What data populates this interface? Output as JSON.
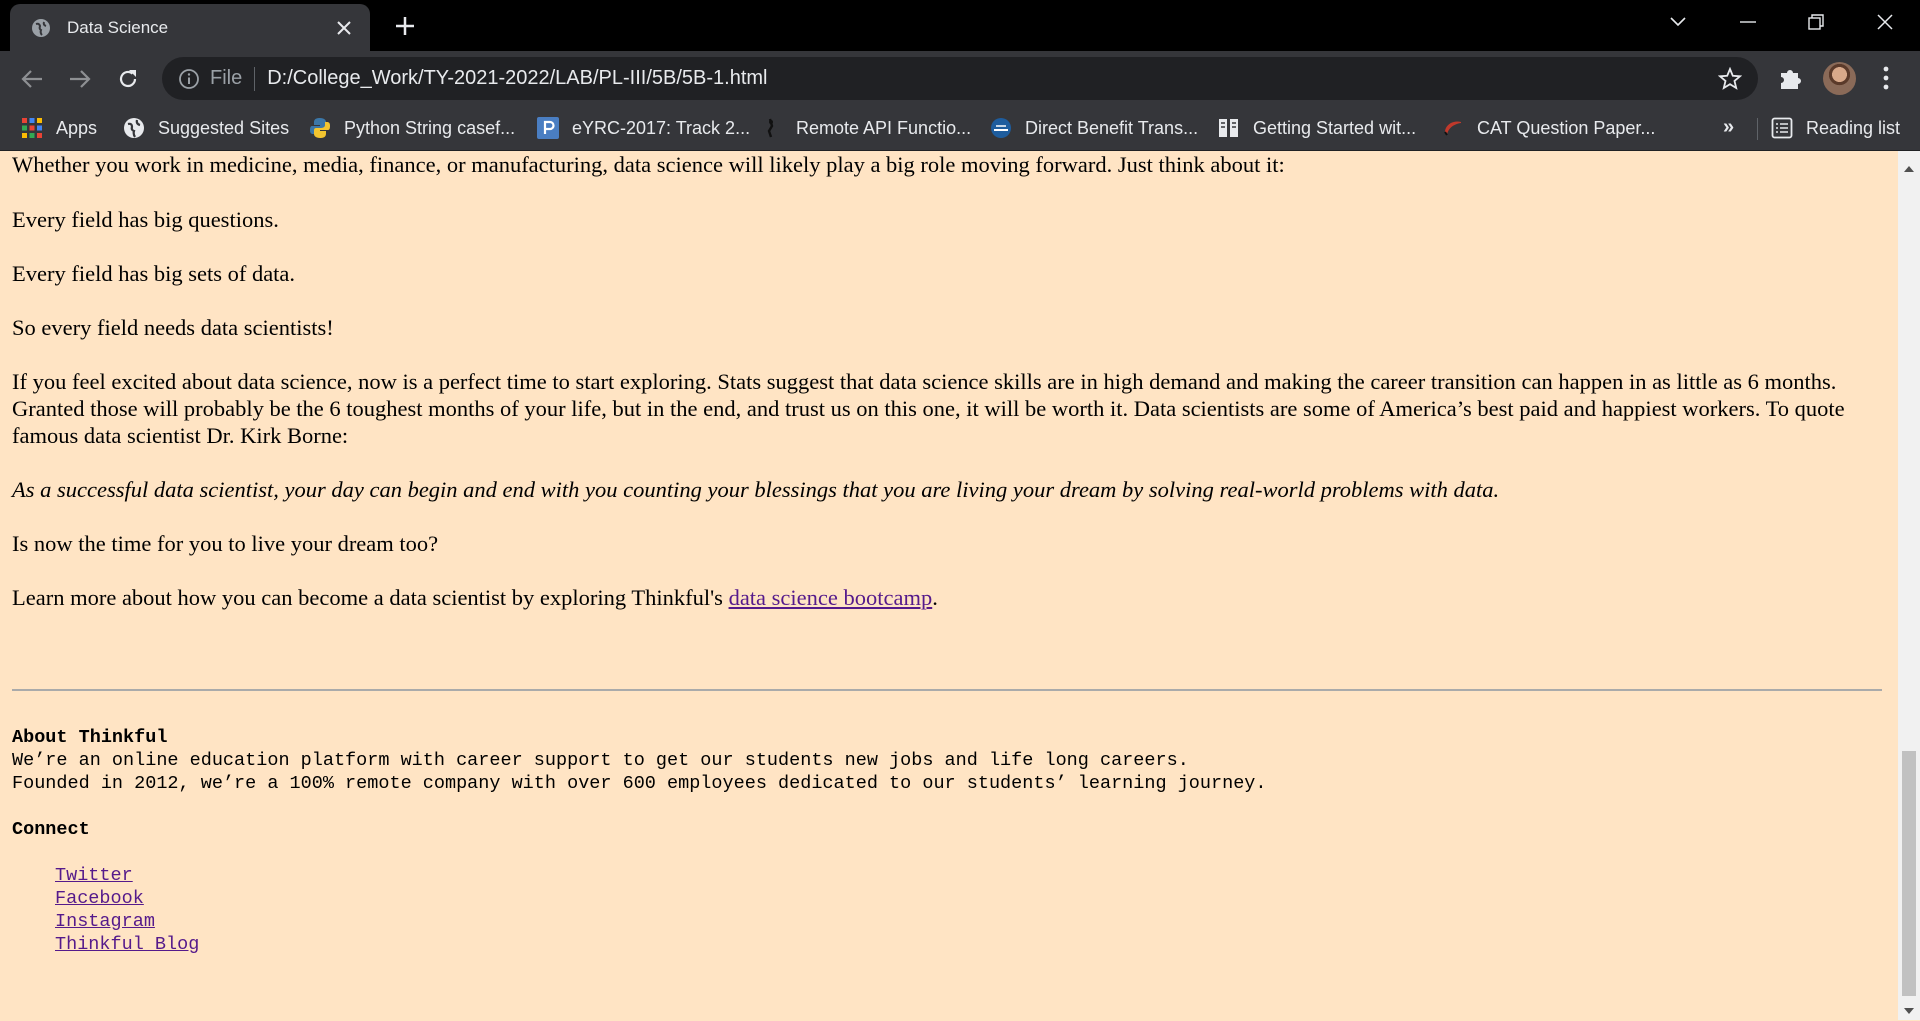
{
  "browser": {
    "tab_title": "Data Science",
    "omnibox": {
      "scheme": "File",
      "url": "D:/College_Work/TY-2021-2022/LAB/PL-III/5B/5B-1.html"
    },
    "bookmarks": [
      {
        "label": "Apps",
        "icon": "apps-grid-icon"
      },
      {
        "label": "Suggested Sites",
        "icon": "globe-icon"
      },
      {
        "label": "Python String casef...",
        "icon": "python-icon"
      },
      {
        "label": "eYRC-2017: Track 2...",
        "icon": "p-logo-icon"
      },
      {
        "label": "Remote API Functio...",
        "icon": "robot-icon"
      },
      {
        "label": "Direct Benefit Trans...",
        "icon": "dbt-icon"
      },
      {
        "label": "Getting Started wit...",
        "icon": "book-icon"
      },
      {
        "label": "CAT Question Paper...",
        "icon": "cat-icon"
      }
    ],
    "reading_list": "Reading list"
  },
  "article": {
    "p1": "Whether you work in medicine, media, finance, or manufacturing, data science will likely play a big role moving forward. Just think about it:",
    "p2": "Every field has big questions.",
    "p3": "Every field has big sets of data.",
    "p4": "So every field needs data scientists!",
    "p5": "If you feel excited about data science, now is a perfect time to start exploring. Stats suggest that data science skills are in high demand and making the career transition can happen in as little as 6 months. Granted those will probably be the 6 toughest months of your life, but in the end, and trust us on this one, it will be worth it. Data scientists are some of America’s best paid and happiest workers. To quote famous data scientist Dr. Kirk Borne:",
    "quote": "As a successful data scientist, your day can begin and end with you counting your blessings that you are living your dream by solving real-world problems with data.",
    "p6": "Is now the time for you to live your dream too?",
    "p7_before": "Learn more about how you can become a data scientist by exploring Thinkful's ",
    "p7_link": "data science bootcamp",
    "p7_after": "."
  },
  "footer": {
    "about_heading": "About Thinkful",
    "about_line1": "We’re an online education platform with career support to get our students new jobs and life long careers.",
    "about_line2": "Founded in 2012, we’re a 100% remote company with over 600 employees dedicated to our students’ learning journey.",
    "connect_heading": "Connect",
    "links": [
      "Twitter",
      "Facebook",
      "Instagram",
      "Thinkful Blog"
    ]
  },
  "colors": {
    "page_bg": "#ffe4c4",
    "link": "#551a8b",
    "chrome_dark": "#35363a"
  }
}
